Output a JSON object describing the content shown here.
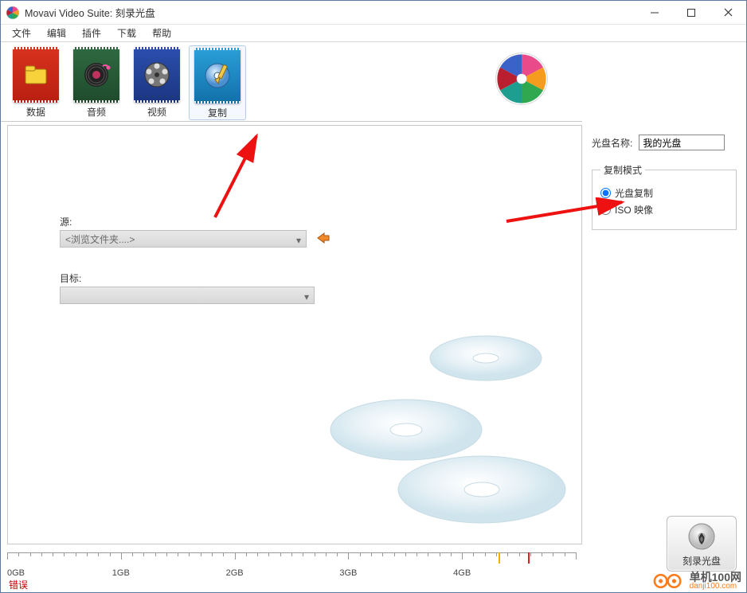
{
  "title": "Movavi Video Suite: 刻录光盘",
  "menu": [
    "文件",
    "编辑",
    "插件",
    "下载",
    "帮助"
  ],
  "tabs": [
    {
      "label": "数据"
    },
    {
      "label": "音频"
    },
    {
      "label": "视频"
    },
    {
      "label": "复制"
    }
  ],
  "selected_tab_index": 3,
  "form": {
    "source_label": "源:",
    "source_value": "<浏览文件夹....>",
    "target_label": "目标:",
    "target_value": ""
  },
  "side": {
    "disc_name_label": "光盘名称:",
    "disc_name_value": "我的光盘",
    "copy_mode_legend": "复制模式",
    "radio_disc_copy": "光盘复制",
    "radio_iso": "ISO 映像",
    "selected_radio": "disc_copy"
  },
  "burn_button_label": "刻录光盘",
  "ruler_labels": [
    "0GB",
    "1GB",
    "2GB",
    "3GB",
    "4GB"
  ],
  "ruler_markers_gb": [
    4.32,
    4.58
  ],
  "ruler_max_gb": 5,
  "status": "错误",
  "watermark": {
    "line1": "单机100网",
    "line2": "danji100.com"
  }
}
